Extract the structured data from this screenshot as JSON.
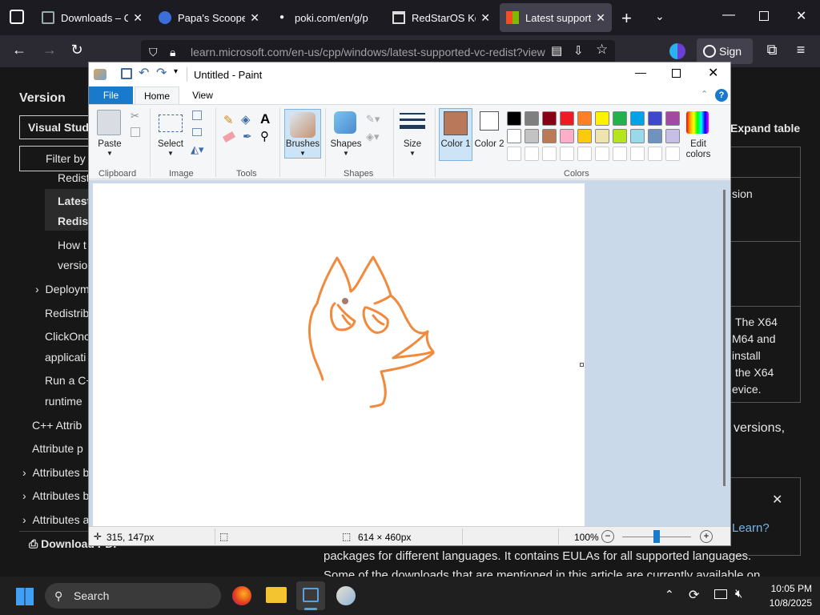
{
  "browser": {
    "tabs": [
      {
        "label": "Downloads – Or",
        "active": false
      },
      {
        "label": "Papa's Scooperi",
        "active": false
      },
      {
        "label": "poki.com/en/g/p",
        "active": false
      },
      {
        "label": "RedStarOS Kore",
        "active": false
      },
      {
        "label": "Latest supportec",
        "active": true
      }
    ],
    "url": "learn.microsoft.com/en-us/cpp/windows/latest-supported-vc-redist?view",
    "sign_in": "Sign in"
  },
  "doc": {
    "version_heading": "Version",
    "version_select": "Visual Studi",
    "filter": "Filter by",
    "nav": [
      "Redist",
      "Latest",
      "Redist",
      "How t",
      "versio",
      "Deploym",
      "Redistrib",
      "ClickOnc",
      "applicati",
      "Run a C+",
      "runtime",
      "C++ Attrib",
      "Attribute p",
      "Attributes b",
      "Attributes b",
      "Attributes a"
    ],
    "download_pdf": "Download PDF",
    "expand_table": "Expand table",
    "right_fragments": [
      "sion",
      "The X64",
      "M64 and",
      "install",
      "the X64",
      "evice.",
      "versions,",
      "Learn?"
    ],
    "bottom_line1": "packages for different languages. It contains EULAs for all supported languages.",
    "bottom_line2": "Some of the downloads that are mentioned in this article are currently available on"
  },
  "paint": {
    "title": "Untitled - Paint",
    "ribbon_tabs": [
      "File",
      "Home",
      "View"
    ],
    "groups": [
      "Clipboard",
      "Image",
      "Tools",
      "Shapes",
      "Colors"
    ],
    "paste_label": "Paste",
    "select_label": "Select",
    "brushes_label": "Brushes",
    "shapes_label": "Shapes",
    "size_label": "Size",
    "color1_label": "Color 1",
    "color2_label": "Color 2",
    "edit_colors_label": "Edit colors",
    "color1_value": "#b9785a",
    "palette": [
      "#000000",
      "#7f7f7f",
      "#880015",
      "#ed1c24",
      "#ff7f27",
      "#fff200",
      "#22b14c",
      "#00a2e8",
      "#3f48cc",
      "#a349a4",
      "#ffffff",
      "#c3c3c3",
      "#b97a57",
      "#ffaec9",
      "#ffc90e",
      "#efe4b0",
      "#b5e61d",
      "#99d9ea",
      "#7092be",
      "#c8bfe7"
    ],
    "status_pos": "315, 147px",
    "status_size": "614 × 460px",
    "zoom": "100%"
  },
  "taskbar": {
    "search": "Search",
    "time": "10:05 PM",
    "date": "10/8/2025"
  }
}
